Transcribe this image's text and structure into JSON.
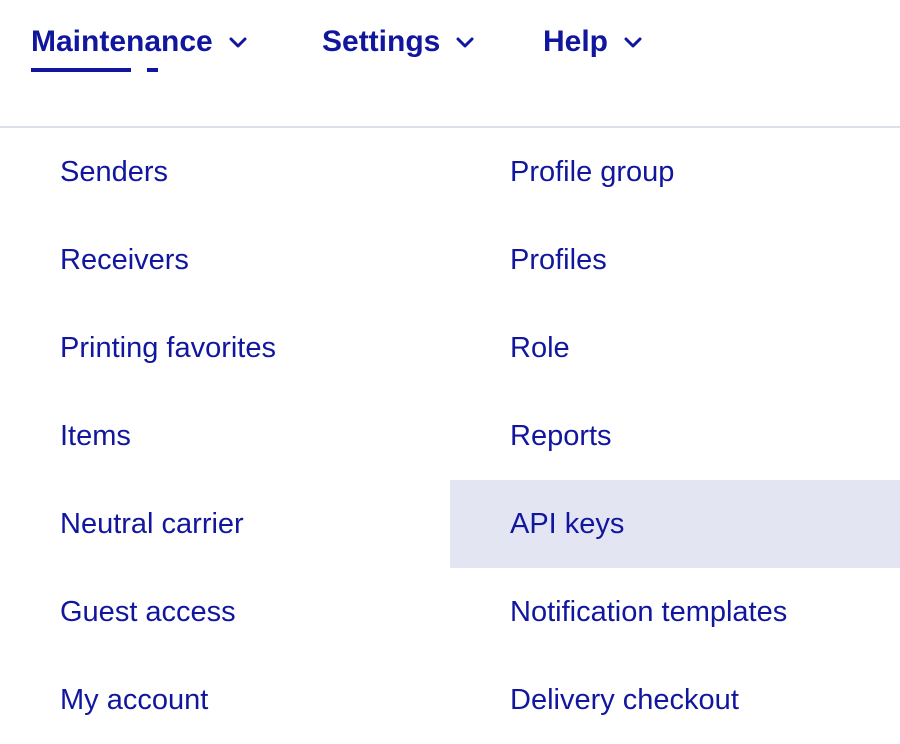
{
  "colors": {
    "accent_blue": "#11169e",
    "highlight_bg": "#e3e5f2",
    "divider": "#dcdfee",
    "page_bg": "#ffffff"
  },
  "topnav": {
    "items": [
      {
        "label": "Maintenance",
        "icon": "chevron-down-icon",
        "active": true
      },
      {
        "label": "Settings",
        "icon": "chevron-down-icon",
        "active": false
      },
      {
        "label": "Help",
        "icon": "chevron-down-icon",
        "active": false
      }
    ]
  },
  "menu": {
    "left_column": [
      {
        "label": "Senders",
        "highlighted": false
      },
      {
        "label": "Receivers",
        "highlighted": false
      },
      {
        "label": "Printing favorites",
        "highlighted": false
      },
      {
        "label": "Items",
        "highlighted": false
      },
      {
        "label": "Neutral carrier",
        "highlighted": false
      },
      {
        "label": "Guest access",
        "highlighted": false
      },
      {
        "label": "My account",
        "highlighted": false
      }
    ],
    "right_column": [
      {
        "label": "Profile group",
        "highlighted": false
      },
      {
        "label": "Profiles",
        "highlighted": false
      },
      {
        "label": "Role",
        "highlighted": false
      },
      {
        "label": "Reports",
        "highlighted": false
      },
      {
        "label": "API keys",
        "highlighted": true
      },
      {
        "label": "Notification templates",
        "highlighted": false
      },
      {
        "label": "Delivery checkout",
        "highlighted": false
      }
    ]
  }
}
